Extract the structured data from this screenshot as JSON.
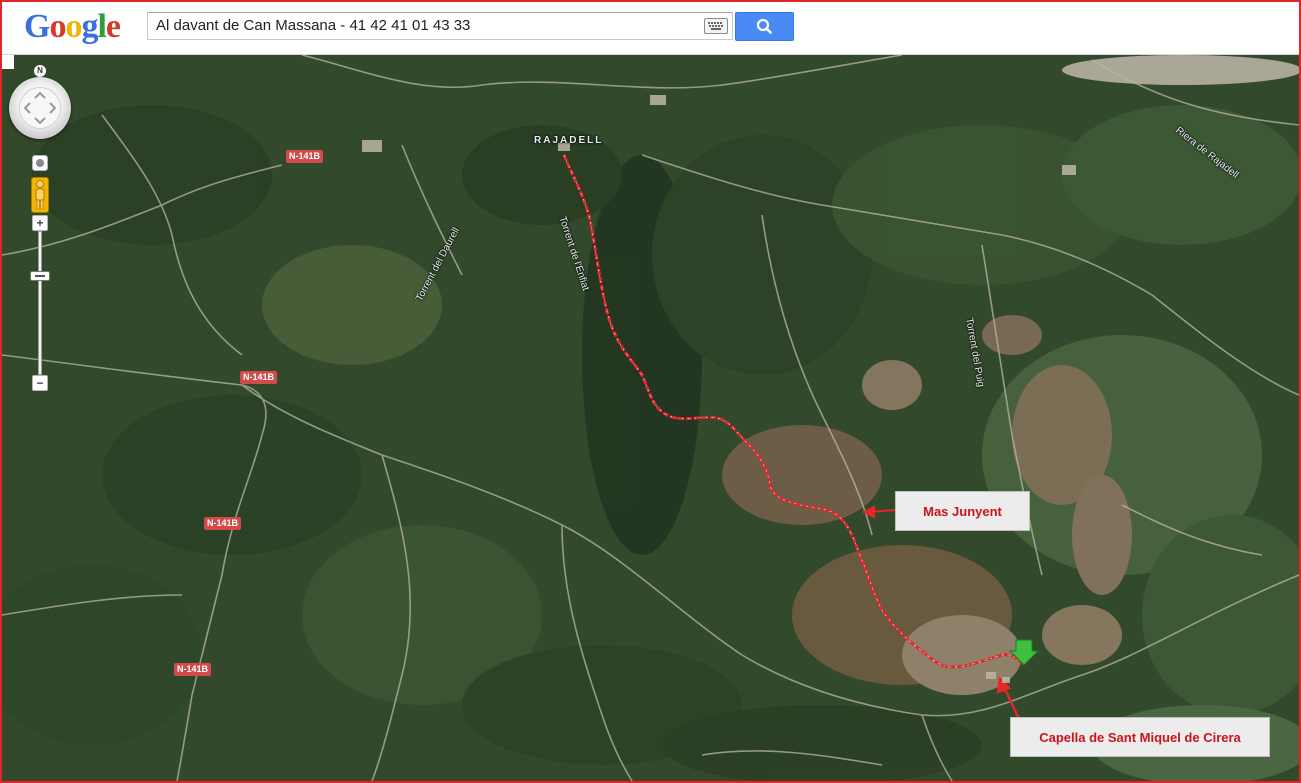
{
  "header": {
    "logo_text": "Google",
    "search": {
      "value": "Al davant de Can Massana - 41 42 41 01 43 33"
    }
  },
  "icons": {
    "logo": "google-logo",
    "keyboard": "keyboard-icon",
    "search": "search-icon",
    "pan": "pan-control-icon",
    "pegman": "pegman-icon",
    "zoom_in": "zoom-in-icon",
    "zoom_out": "zoom-out-icon",
    "marker": "green-arrow-marker-icon"
  },
  "colors": {
    "frame_border": "#e0252b",
    "search_button": "#4a8af4",
    "route": "#e8242c",
    "callout_text": "#c8151c",
    "road_shield": "#d24a4a",
    "marker": "#3fbf3f"
  },
  "map": {
    "view": "satellite",
    "compass": "N",
    "zoom_in": "+",
    "zoom_out": "−",
    "road_labels": {
      "r1": "N-141B",
      "r2": "N-141B",
      "r3": "N-141B",
      "r4": "N-141B"
    },
    "place_labels": {
      "town": "RAJADELL",
      "stream_enfiat": "Torrent de l'Enfiat",
      "stream_daurell": "Torrent del Daurell",
      "stream_puig": "Torrent del Puig",
      "riera": "Riera de Rajadell"
    },
    "callouts": {
      "mas_junyent": "Mas Junyent",
      "capella": "Capella de Sant Miquel de Cirera"
    }
  }
}
